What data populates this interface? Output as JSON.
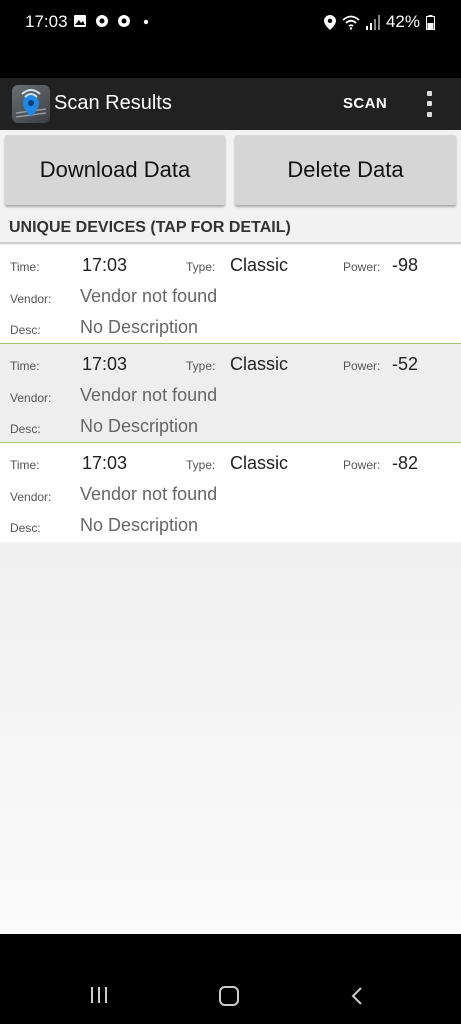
{
  "status_bar": {
    "time": "17:03",
    "battery": "42%",
    "icons": [
      "image-icon",
      "chrome-icon",
      "chrome-icon",
      "dot-icon",
      "location-icon",
      "wifi-icon",
      "signal-icon",
      "battery-icon"
    ]
  },
  "app_bar": {
    "title": "Scan Results",
    "scan_label": "SCAN",
    "logo_icon": "bluetooth-scanner-logo-icon",
    "overflow_icon": "more-vert-icon"
  },
  "actions": {
    "download_label": "Download Data",
    "delete_label": "Delete Data"
  },
  "section_header": "UNIQUE DEVICES (TAP FOR DETAIL)",
  "labels": {
    "time": "Time:",
    "type": "Type:",
    "power": "Power:",
    "vendor": "Vendor:",
    "desc": "Desc:"
  },
  "devices": [
    {
      "time": "17:03",
      "type": "Classic",
      "power": "-98",
      "vendor": "Vendor not found",
      "desc": "No Description"
    },
    {
      "time": "17:03",
      "type": "Classic",
      "power": "-52",
      "vendor": "Vendor not found",
      "desc": "No Description"
    },
    {
      "time": "17:03",
      "type": "Classic",
      "power": "-82",
      "vendor": "Vendor not found",
      "desc": "No Description"
    }
  ],
  "colors": {
    "app_bar": "#212121",
    "row_divider": "#a8c07a",
    "button_bg": "#d6d6d6"
  },
  "nav_bar": {
    "icons": [
      "recents-icon",
      "home-icon",
      "back-icon"
    ]
  }
}
